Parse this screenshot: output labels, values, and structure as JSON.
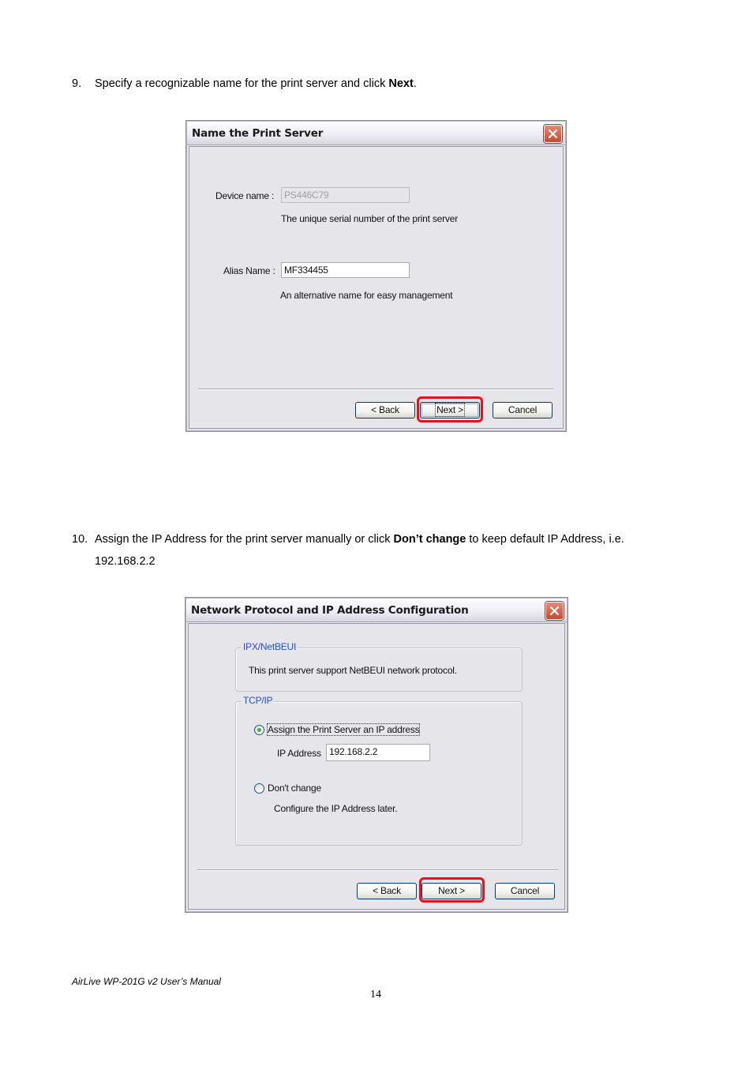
{
  "step9": {
    "number": "9.",
    "text_before": "Specify a recognizable name for the print server and click ",
    "text_bold": "Next",
    "text_after": "."
  },
  "dialog1": {
    "title": "Name the Print Server",
    "device_name_label": "Device name :",
    "device_name_value": "PS446C79",
    "device_name_hint": "The unique serial number of the print server",
    "alias_name_label": "Alias Name :",
    "alias_name_value": "MF334455",
    "alias_name_hint": "An alternative name for easy management",
    "back_label": "< Back",
    "next_label": "Next >",
    "cancel_label": "Cancel",
    "highlight_color": "#e8111b"
  },
  "step10": {
    "number": "10.",
    "text_before": "Assign the IP Address for the print server manually or click ",
    "text_bold": "Don’t change",
    "text_after": " to keep default IP Address, i.e.",
    "line2": "192.168.2.2"
  },
  "dialog2": {
    "title": "Network Protocol and IP Address Configuration",
    "group1_title": "IPX/NetBEUI",
    "group1_text": "This print server support NetBEUI network protocol.",
    "group2_title": "TCP/IP",
    "radio_assign_label": "Assign the Print Server an IP address",
    "radio_assign_checked": true,
    "ip_address_label": "IP Address",
    "ip_address_value": "192.168.2.2",
    "radio_dont_change_label": "Don't change",
    "radio_dont_change_checked": false,
    "dont_change_hint": "Configure the IP Address later.",
    "back_label": "< Back",
    "next_label": "Next >",
    "cancel_label": "Cancel",
    "highlight_color": "#e8111b"
  },
  "footer": {
    "manual_title": "AirLive WP-201G v2 User’s Manual",
    "page_number": "14"
  }
}
